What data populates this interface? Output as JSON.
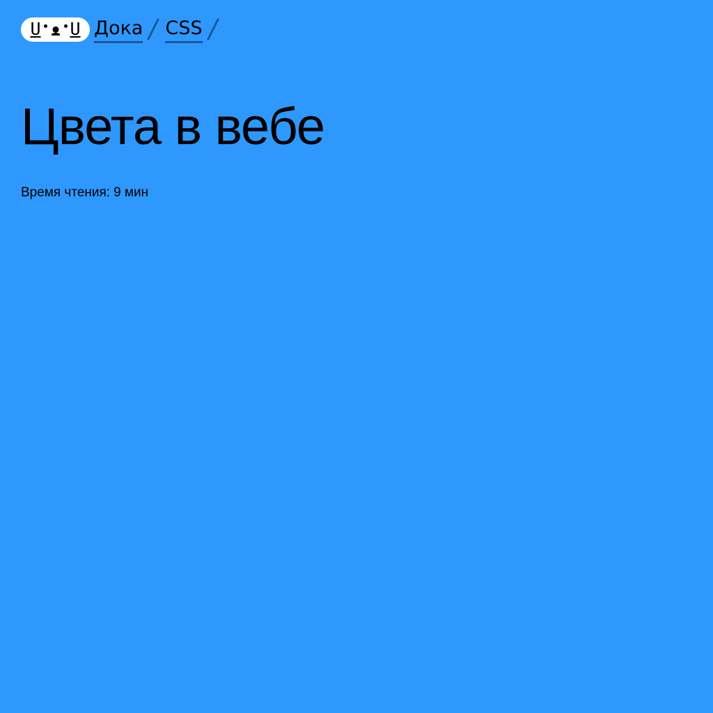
{
  "header": {
    "logo": {
      "text_left": "U",
      "text_right": "U",
      "icon": "dog-face-logo-icon",
      "background": "#ffffff"
    },
    "breadcrumbs": [
      {
        "label": "Дока"
      },
      {
        "label": "CSS"
      }
    ],
    "separator_icon": "slash-separator-icon"
  },
  "article": {
    "title": "Цвета в вебе",
    "reading_time_label": "Время чтения:",
    "reading_time_value": "9 мин"
  },
  "colors": {
    "page_background": "#2e98ff",
    "text": "#000000"
  }
}
